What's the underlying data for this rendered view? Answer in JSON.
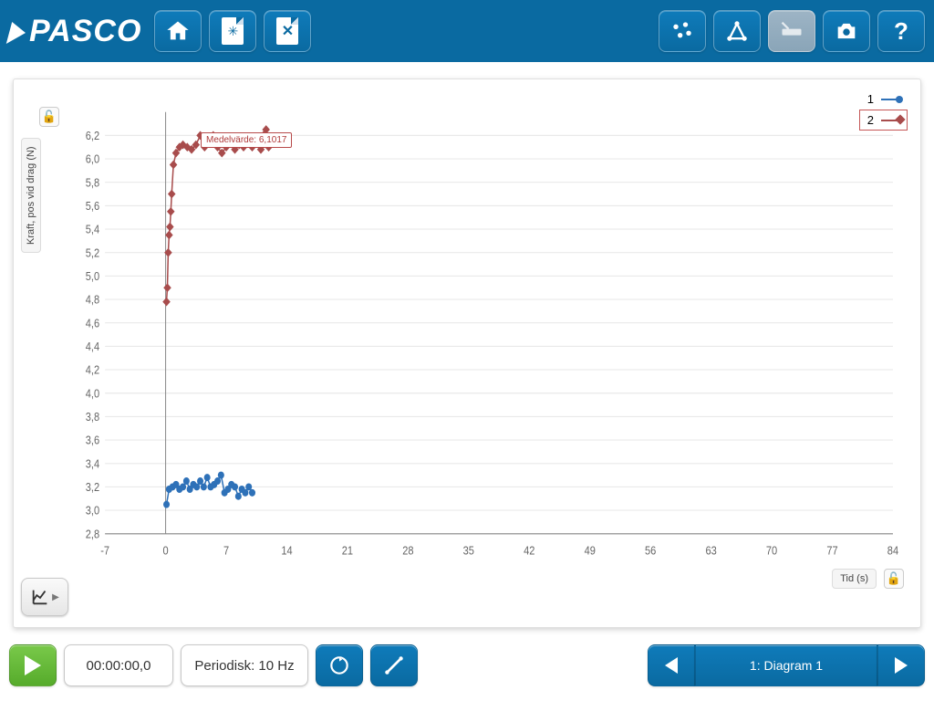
{
  "brand": "PASCO",
  "footer": {
    "time": "00:00:00,0",
    "mode": "Periodisk: 10 Hz",
    "pager_label": "1: Diagram 1"
  },
  "chart": {
    "ylabel": "Kraft, pos vid drag (N)",
    "xlabel": "Tid (s)",
    "legend": [
      {
        "label": "1",
        "selected": false
      },
      {
        "label": "2",
        "selected": true
      }
    ],
    "annotation": "Medelvärde: 6,1017"
  },
  "chart_data": {
    "type": "scatter",
    "xlabel": "Tid (s)",
    "ylabel": "Kraft, pos vid drag (N)",
    "xlim": [
      -7,
      84
    ],
    "ylim": [
      2.8,
      6.4
    ],
    "xticks": [
      -7,
      0,
      7,
      14,
      21,
      28,
      35,
      42,
      49,
      56,
      63,
      70,
      77,
      84
    ],
    "yticks": [
      2.8,
      3.0,
      3.2,
      3.4,
      3.6,
      3.8,
      4.0,
      4.2,
      4.4,
      4.6,
      4.8,
      5.0,
      5.2,
      5.4,
      5.6,
      5.8,
      6.0,
      6.2
    ],
    "series": [
      {
        "name": "1",
        "color": "#2e71b8",
        "marker": "circle",
        "points": [
          {
            "x": 0.1,
            "y": 3.05
          },
          {
            "x": 0.4,
            "y": 3.18
          },
          {
            "x": 0.8,
            "y": 3.2
          },
          {
            "x": 1.2,
            "y": 3.22
          },
          {
            "x": 1.6,
            "y": 3.18
          },
          {
            "x": 2.0,
            "y": 3.2
          },
          {
            "x": 2.4,
            "y": 3.25
          },
          {
            "x": 2.8,
            "y": 3.18
          },
          {
            "x": 3.2,
            "y": 3.22
          },
          {
            "x": 3.6,
            "y": 3.2
          },
          {
            "x": 4.0,
            "y": 3.25
          },
          {
            "x": 4.4,
            "y": 3.2
          },
          {
            "x": 4.8,
            "y": 3.28
          },
          {
            "x": 5.2,
            "y": 3.2
          },
          {
            "x": 5.6,
            "y": 3.22
          },
          {
            "x": 6.0,
            "y": 3.25
          },
          {
            "x": 6.4,
            "y": 3.3
          },
          {
            "x": 6.8,
            "y": 3.15
          },
          {
            "x": 7.2,
            "y": 3.18
          },
          {
            "x": 7.6,
            "y": 3.22
          },
          {
            "x": 8.0,
            "y": 3.2
          },
          {
            "x": 8.4,
            "y": 3.12
          },
          {
            "x": 8.8,
            "y": 3.18
          },
          {
            "x": 9.2,
            "y": 3.15
          },
          {
            "x": 9.6,
            "y": 3.2
          },
          {
            "x": 10.0,
            "y": 3.15
          }
        ]
      },
      {
        "name": "2",
        "color": "#a84c4c",
        "marker": "diamond",
        "annotation": "Medelvärde: 6,1017",
        "points": [
          {
            "x": 0.1,
            "y": 4.78
          },
          {
            "x": 0.2,
            "y": 4.9
          },
          {
            "x": 0.3,
            "y": 5.2
          },
          {
            "x": 0.4,
            "y": 5.35
          },
          {
            "x": 0.5,
            "y": 5.42
          },
          {
            "x": 0.6,
            "y": 5.55
          },
          {
            "x": 0.7,
            "y": 5.7
          },
          {
            "x": 0.9,
            "y": 5.95
          },
          {
            "x": 1.2,
            "y": 6.05
          },
          {
            "x": 1.6,
            "y": 6.1
          },
          {
            "x": 2.0,
            "y": 6.12
          },
          {
            "x": 2.5,
            "y": 6.1
          },
          {
            "x": 3.0,
            "y": 6.08
          },
          {
            "x": 3.5,
            "y": 6.12
          },
          {
            "x": 4.0,
            "y": 6.2
          },
          {
            "x": 4.5,
            "y": 6.1
          },
          {
            "x": 5.0,
            "y": 6.15
          },
          {
            "x": 5.5,
            "y": 6.2
          },
          {
            "x": 6.0,
            "y": 6.1
          },
          {
            "x": 6.5,
            "y": 6.05
          },
          {
            "x": 7.0,
            "y": 6.1
          },
          {
            "x": 7.5,
            "y": 6.15
          },
          {
            "x": 8.0,
            "y": 6.08
          },
          {
            "x": 8.5,
            "y": 6.12
          },
          {
            "x": 9.0,
            "y": 6.1
          },
          {
            "x": 9.5,
            "y": 6.18
          },
          {
            "x": 10.0,
            "y": 6.1
          },
          {
            "x": 10.5,
            "y": 6.15
          },
          {
            "x": 11.0,
            "y": 6.08
          },
          {
            "x": 11.3,
            "y": 6.2
          },
          {
            "x": 11.6,
            "y": 6.25
          },
          {
            "x": 11.9,
            "y": 6.1
          }
        ]
      }
    ]
  }
}
